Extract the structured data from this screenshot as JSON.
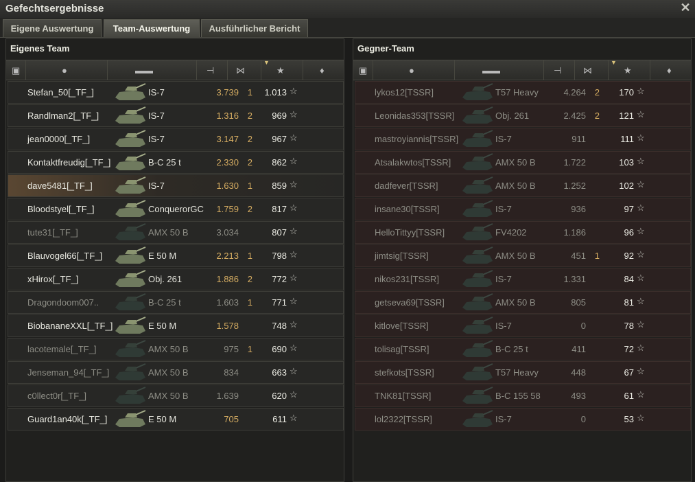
{
  "window": {
    "title": "Gefechtsergebnisse"
  },
  "tabs": [
    {
      "label": "Eigene Auswertung",
      "active": false
    },
    {
      "label": "Team-Auswertung",
      "active": true
    },
    {
      "label": "Ausführlicher Bericht",
      "active": false
    }
  ],
  "own_team": {
    "title": "Eigenes Team",
    "rows": [
      {
        "name": "Stefan_50[_TF_]",
        "tank": "IS-7",
        "damage": "3.739",
        "kills": "1",
        "xp": "1.013",
        "dim": false,
        "highlight": false
      },
      {
        "name": "Randlman2[_TF_]",
        "tank": "IS-7",
        "damage": "1.316",
        "kills": "2",
        "xp": "969",
        "dim": false,
        "highlight": false
      },
      {
        "name": "jean0000[_TF_]",
        "tank": "IS-7",
        "damage": "3.147",
        "kills": "2",
        "xp": "967",
        "dim": false,
        "highlight": false
      },
      {
        "name": "Kontaktfreudig[_TF_]",
        "tank": "B-C 25 t",
        "damage": "2.330",
        "kills": "2",
        "xp": "862",
        "dim": false,
        "highlight": false
      },
      {
        "name": "dave5481[_TF_]",
        "tank": "IS-7",
        "damage": "1.630",
        "kills": "1",
        "xp": "859",
        "dim": false,
        "highlight": true
      },
      {
        "name": "Bloodstyel[_TF_]",
        "tank": "ConquerorGC",
        "damage": "1.759",
        "kills": "2",
        "xp": "817",
        "dim": false,
        "highlight": false
      },
      {
        "name": "tute31[_TF_]",
        "tank": "AMX 50 B",
        "damage": "3.034",
        "kills": "",
        "xp": "807",
        "dim": true,
        "highlight": false
      },
      {
        "name": "Blauvogel66[_TF_]",
        "tank": "E 50 M",
        "damage": "2.213",
        "kills": "1",
        "xp": "798",
        "dim": false,
        "highlight": false
      },
      {
        "name": "xHirox[_TF_]",
        "tank": "Obj. 261",
        "damage": "1.886",
        "kills": "2",
        "xp": "772",
        "dim": false,
        "highlight": false
      },
      {
        "name": "Dragondoom007..",
        "tank": "B-C 25 t",
        "damage": "1.603",
        "kills": "1",
        "xp": "771",
        "dim": true,
        "highlight": false
      },
      {
        "name": "BiobananeXXL[_TF_]",
        "tank": "E 50 M",
        "damage": "1.578",
        "kills": "",
        "xp": "748",
        "dim": false,
        "highlight": false
      },
      {
        "name": "lacotemale[_TF_]",
        "tank": "AMX 50 B",
        "damage": "975",
        "kills": "1",
        "xp": "690",
        "dim": true,
        "highlight": false
      },
      {
        "name": "Jenseman_94[_TF_]",
        "tank": "AMX 50 B",
        "damage": "834",
        "kills": "",
        "xp": "663",
        "dim": true,
        "highlight": false
      },
      {
        "name": "c0llect0r[_TF_]",
        "tank": "AMX 50 B",
        "damage": "1.639",
        "kills": "",
        "xp": "620",
        "dim": true,
        "highlight": false
      },
      {
        "name": "Guard1an40k[_TF_]",
        "tank": "E 50 M",
        "damage": "705",
        "kills": "",
        "xp": "611",
        "dim": false,
        "highlight": false
      }
    ]
  },
  "enemy_team": {
    "title": "Gegner-Team",
    "rows": [
      {
        "name": "lykos12[TSSR]",
        "tank": "T57 Heavy",
        "damage": "4.264",
        "kills": "2",
        "xp": "170",
        "dim": true
      },
      {
        "name": "Leonidas353[TSSR]",
        "tank": "Obj. 261",
        "damage": "2.425",
        "kills": "2",
        "xp": "121",
        "dim": true
      },
      {
        "name": "mastroyiannis[TSSR]",
        "tank": "IS-7",
        "damage": "911",
        "kills": "",
        "xp": "111",
        "dim": true
      },
      {
        "name": "Atsalakwtos[TSSR]",
        "tank": "AMX 50 B",
        "damage": "1.722",
        "kills": "",
        "xp": "103",
        "dim": true
      },
      {
        "name": "dadfever[TSSR]",
        "tank": "AMX 50 B",
        "damage": "1.252",
        "kills": "",
        "xp": "102",
        "dim": true
      },
      {
        "name": "insane30[TSSR]",
        "tank": "IS-7",
        "damage": "936",
        "kills": "",
        "xp": "97",
        "dim": true
      },
      {
        "name": "HelloTittyy[TSSR]",
        "tank": "FV4202",
        "damage": "1.186",
        "kills": "",
        "xp": "96",
        "dim": true
      },
      {
        "name": "jimtsig[TSSR]",
        "tank": "AMX 50 B",
        "damage": "451",
        "kills": "1",
        "xp": "92",
        "dim": true
      },
      {
        "name": "nikos231[TSSR]",
        "tank": "IS-7",
        "damage": "1.331",
        "kills": "",
        "xp": "84",
        "dim": true
      },
      {
        "name": "getseva69[TSSR]",
        "tank": "AMX 50 B",
        "damage": "805",
        "kills": "",
        "xp": "81",
        "dim": true
      },
      {
        "name": "kitlove[TSSR]",
        "tank": "IS-7",
        "damage": "0",
        "kills": "",
        "xp": "78",
        "dim": true
      },
      {
        "name": "tolisag[TSSR]",
        "tank": "B-C 25 t",
        "damage": "411",
        "kills": "",
        "xp": "72",
        "dim": true
      },
      {
        "name": "stefkots[TSSR]",
        "tank": "T57 Heavy",
        "damage": "448",
        "kills": "",
        "xp": "67",
        "dim": true
      },
      {
        "name": "TNK81[TSSR]",
        "tank": "B-C 155 58",
        "damage": "493",
        "kills": "",
        "xp": "61",
        "dim": true
      },
      {
        "name": "lol2322[TSSR]",
        "tank": "IS-7",
        "damage": "0",
        "kills": "",
        "xp": "53",
        "dim": true
      }
    ]
  },
  "icons": {
    "close": "close-icon",
    "columns": [
      "rank-icon",
      "player-icon",
      "tank-icon",
      "damage-icon",
      "kills-icon",
      "experience-star-icon",
      "medal-icon"
    ]
  },
  "colors": {
    "damage": "#d6ad62",
    "highlight": "#5a4732",
    "enemy_row": "#2b2120"
  }
}
